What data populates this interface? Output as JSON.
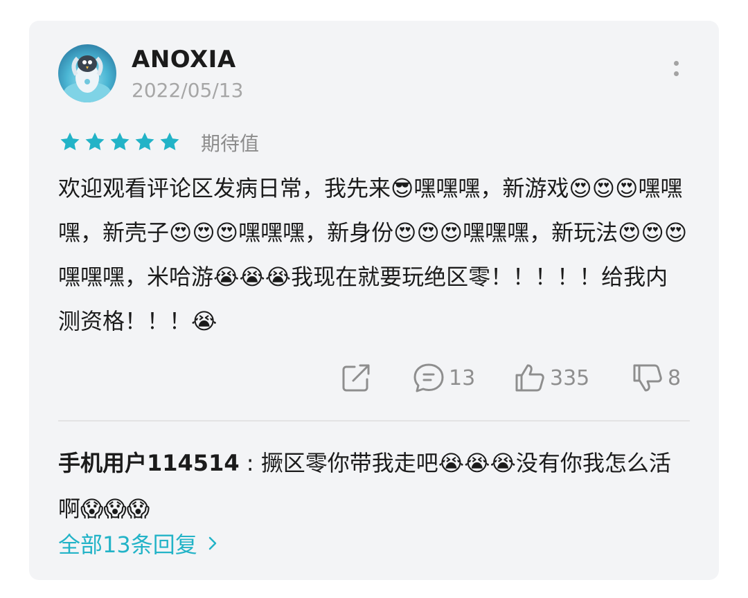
{
  "review": {
    "username": "ANOXIA",
    "date": "2022/05/13",
    "rating": 5,
    "rating_label": "期待值",
    "star_color": "#22b3c7",
    "text": "欢迎观看评论区发病日常，我先来😎嘿嘿嘿，新游戏😍😍😍嘿嘿嘿，新壳子😍😍😍嘿嘿嘿，新身份😍😍😍嘿嘿嘿，新玩法😍😍😍嘿嘿嘿，米哈游😭😭😭我现在就要玩绝区零！！！！！给我内测资格！！！😭"
  },
  "actions": {
    "share_icon": "share-icon",
    "comments_count": "13",
    "likes_count": "335",
    "dislikes_count": "8"
  },
  "reply": {
    "username": "手机用户114514",
    "separator": ":",
    "text": "撅区零你带我走吧😭😭😭没有你我怎么活啊😱😱😱"
  },
  "all_replies_link": "全部13条回复",
  "accent_color": "#22b3c7"
}
